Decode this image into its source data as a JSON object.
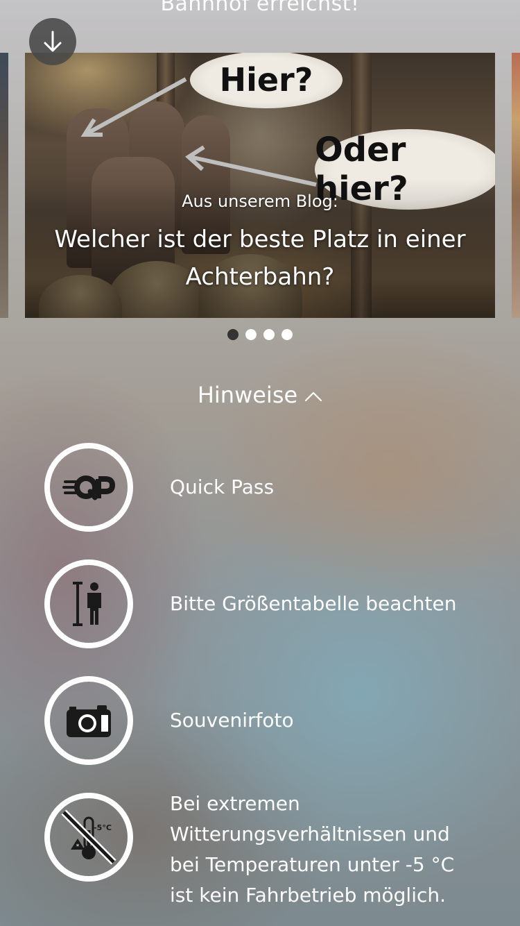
{
  "top_text": "Bahnhof erreichst!",
  "carousel": {
    "kicker": "Aus unserem Blog:",
    "title": "Welcher ist der beste Platz in einer Achterbahn?",
    "bubble_one": "Hier?",
    "bubble_two": "Oder hier?",
    "dots_total": 4,
    "active_dot": 0
  },
  "section": {
    "title": "Hinweise"
  },
  "hints": [
    {
      "label": "Quick Pass",
      "icon": "quick-pass-icon"
    },
    {
      "label": "Bitte Größentabelle beachten",
      "icon": "height-chart-icon"
    },
    {
      "label": "Souvenirfoto",
      "icon": "camera-icon"
    },
    {
      "label": "Bei extremen Witterungsverhältnissen und bei Temperaturen unter -5 °C ist kein Fahrbetrieb möglich.",
      "icon": "no-cold-weather-icon",
      "icon_text": "-5°C"
    }
  ]
}
